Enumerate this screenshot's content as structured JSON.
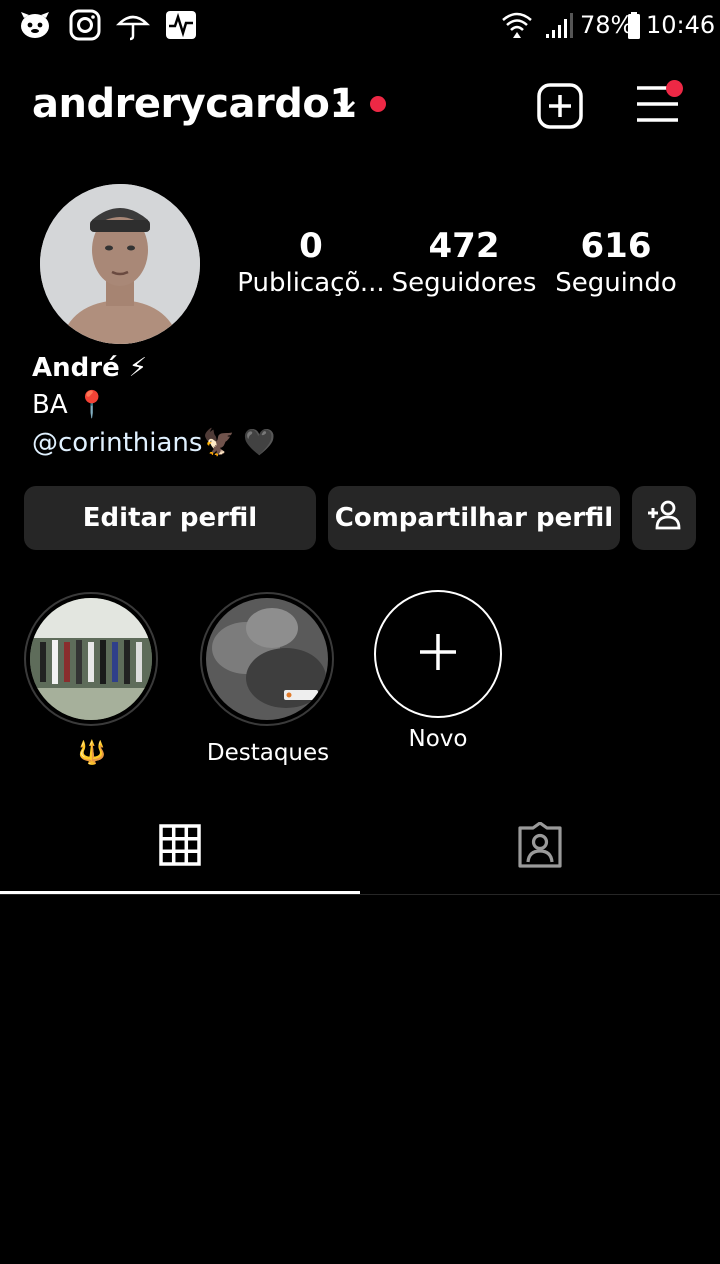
{
  "status_bar": {
    "battery": "78%",
    "time": "10:46",
    "icons": [
      "app-icon",
      "instagram-icon",
      "umbrella-icon",
      "activity-icon",
      "wifi-icon",
      "signal-icon",
      "battery-icon"
    ]
  },
  "header": {
    "username": "andrerycardo1",
    "icons": [
      "chevron-down-icon",
      "notification-dot",
      "create-post-icon",
      "menu-icon"
    ]
  },
  "profile": {
    "stats": [
      {
        "value": "0",
        "label": "Publicaçõ..."
      },
      {
        "value": "472",
        "label": "Seguidores"
      },
      {
        "value": "616",
        "label": "Seguindo"
      }
    ],
    "name": "André ⚡",
    "bio_line1": "BA 📍",
    "bio_line2": "@corinthians🦅 🖤"
  },
  "actions": {
    "edit": "Editar perfil",
    "share": "Compartilhar perfil"
  },
  "highlights": [
    {
      "label": "🔱"
    },
    {
      "label": "Destaques"
    },
    {
      "label": "Novo"
    }
  ],
  "tabs": [
    "grid-tab",
    "tagged-tab"
  ],
  "colors": {
    "background": "#000000",
    "button_bg": "#262626",
    "notification": "#ed2845"
  }
}
